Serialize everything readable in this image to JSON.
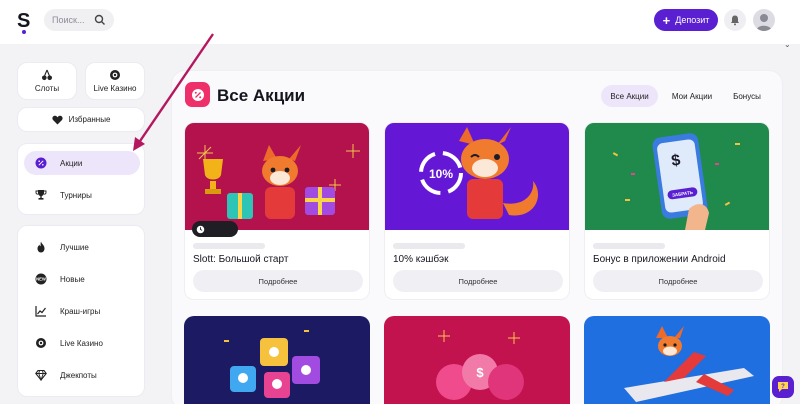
{
  "header": {
    "search_placeholder": "Поиск...",
    "deposit_label": "Депозит",
    "colors": {
      "brand": "#5a1fd1",
      "logo_dot": "#5a1fd1"
    }
  },
  "sidebar": {
    "tiles": [
      {
        "label": "Слоты",
        "icon": "cherries-icon"
      },
      {
        "label": "Live Казино",
        "icon": "poker-chip-icon"
      }
    ],
    "favorites": {
      "label": "Избранные",
      "icon": "heart-icon"
    },
    "group1": [
      {
        "label": "Акции",
        "icon": "percent-icon",
        "active": true
      },
      {
        "label": "Турниры",
        "icon": "trophy-icon"
      }
    ],
    "group2": [
      {
        "label": "Лучшие",
        "icon": "fire-icon"
      },
      {
        "label": "Новые",
        "icon": "new-icon"
      },
      {
        "label": "Краш-игры",
        "icon": "chart-icon"
      },
      {
        "label": "Live Казино",
        "icon": "poker-chip-icon"
      },
      {
        "label": "Джекпоты",
        "icon": "diamond-icon"
      }
    ]
  },
  "main": {
    "title": "Все Акции",
    "tabs": [
      {
        "label": "Все Акции",
        "active": true
      },
      {
        "label": "Мои Акции"
      },
      {
        "label": "Бонусы"
      }
    ],
    "promos": [
      {
        "title": "Slott: Большой старт",
        "button": "Подробнее",
        "banner_color": "#b3124d"
      },
      {
        "title": "10% кэшбэк",
        "button": "Подробнее",
        "banner_color": "#6418d6",
        "banner_text": "10%"
      },
      {
        "title": "Бонус в приложении Android",
        "button": "Подробнее",
        "banner_color": "#1f8a4c",
        "banner_text": "ЗАБРАТЬ"
      }
    ],
    "promos_row2_colors": [
      "#1c1a63",
      "#c3134f",
      "#1f6fe0"
    ]
  },
  "chat_icon": "chat-bubble-icon"
}
